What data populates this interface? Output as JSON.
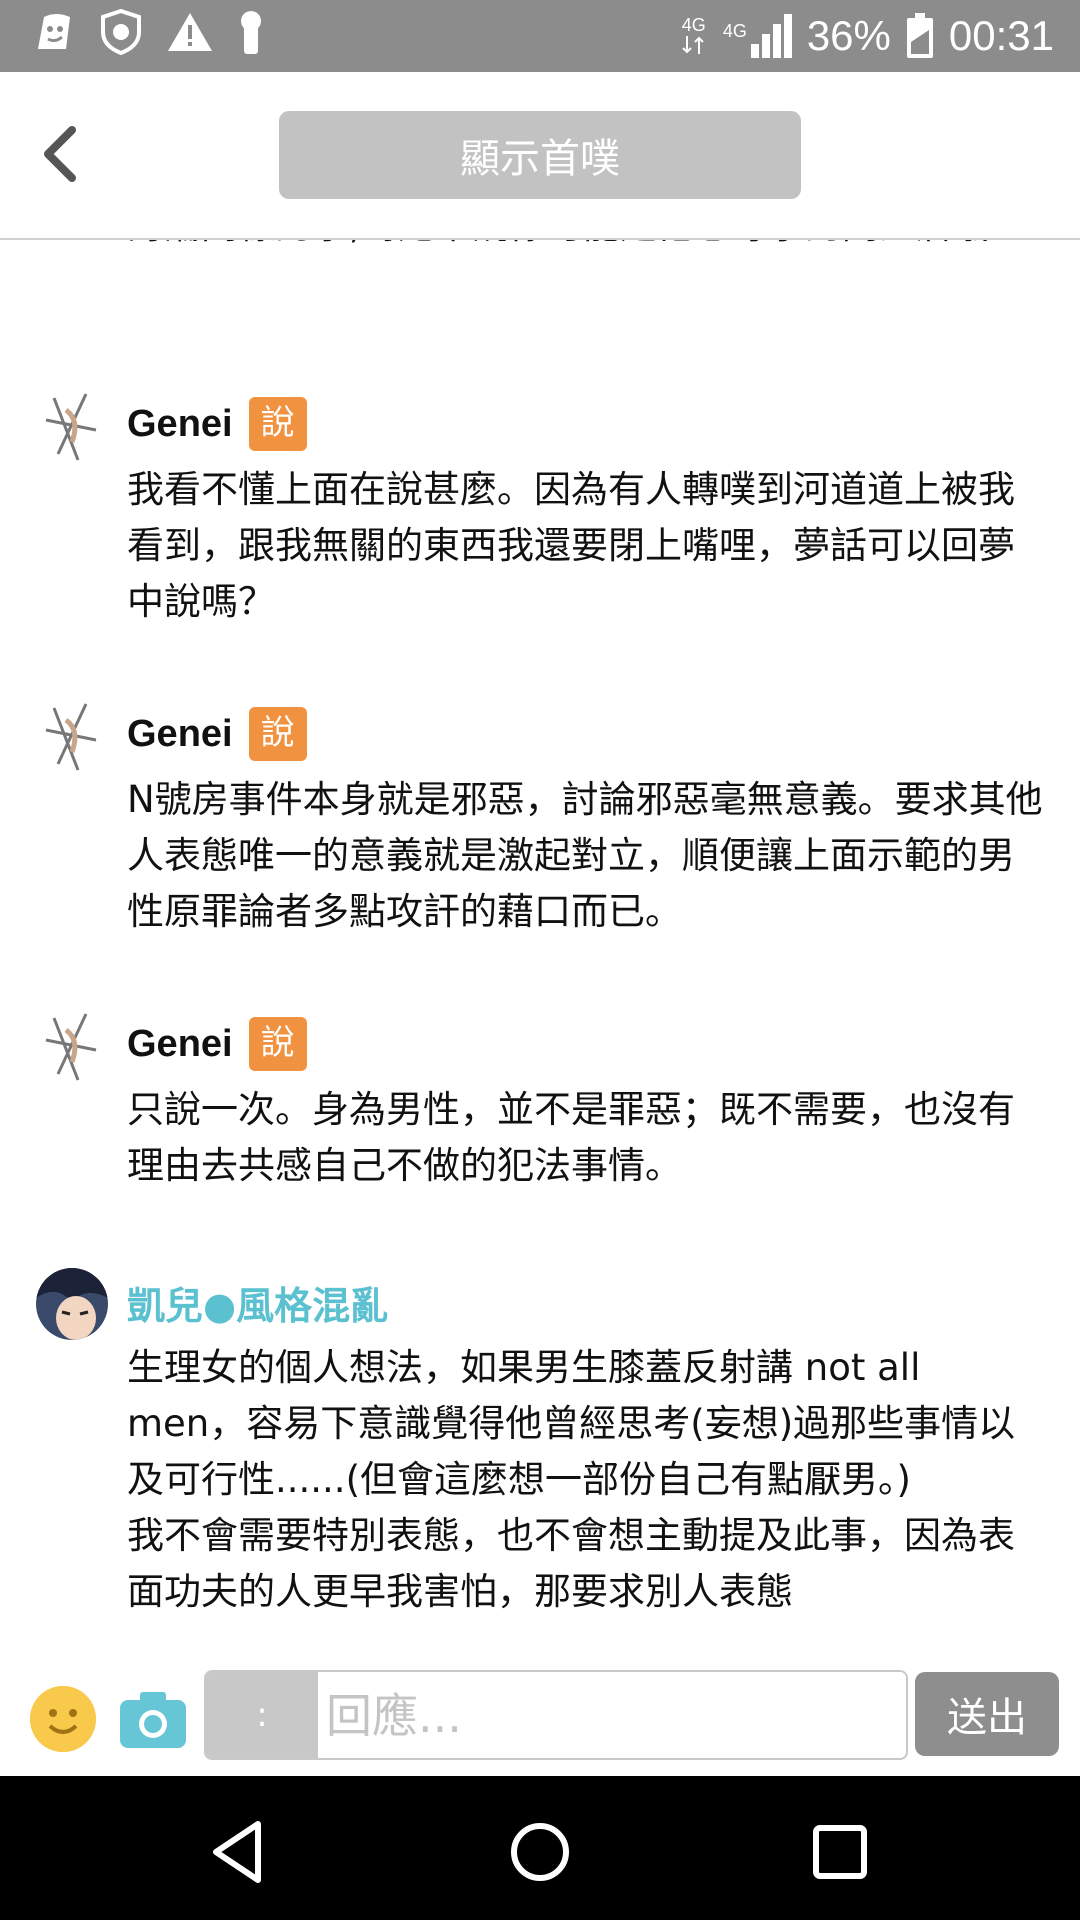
{
  "status_bar": {
    "network_left": "4G",
    "network_right": "4G",
    "battery": "36%",
    "time": "00:31"
  },
  "header": {
    "show_first_label": "顯示首噗"
  },
  "feed": {
    "partial_top_text": "討論同樣的事,對她來說你可能是他想尋求的同溫層哦XD",
    "responses": [
      {
        "name": "Genei",
        "qualifier": "說",
        "text": "我看不懂上面在說甚麼。因為有人轉噗到河道道上被我看到，跟我無關的東西我還要閉上嘴哩，夢話可以回夢中說嗎？"
      },
      {
        "name": "Genei",
        "qualifier": "說",
        "text": "N號房事件本身就是邪惡，討論邪惡毫無意義。要求其他人表態唯一的意義就是激起對立，順便讓上面示範的男性原罪論者多點攻訐的藉口而已。"
      },
      {
        "name": "Genei",
        "qualifier": "說",
        "text": "只說一次。身為男性，並不是罪惡；既不需要，也沒有理由去共感自己不做的犯法事情。"
      },
      {
        "name": "凱兒●風格混亂",
        "qualifier": "",
        "text": "生理女的個人想法，如果男生膝蓋反射講 not all men，容易下意識覺得他曾經思考(妄想)過那些事情以及可行性......(但會這麼想一部份自己有點厭男。)\n我不會需要特別表態，也不會想主動提及此事，因為表面功夫的人更早我害怕，那要求別人表態"
      }
    ]
  },
  "reply_bar": {
    "qualifier_value": ":",
    "placeholder": "回應...",
    "send_label": "送出"
  },
  "colors": {
    "status_bar": "#8c8c8c",
    "qualifier_bg": "#f09240",
    "teal_name": "#5bc0d0",
    "send_btn": "#8e8e8e"
  },
  "icons": {
    "status_left": [
      "face-icon",
      "shield-icon",
      "warning-icon",
      "keyhole-icon"
    ],
    "nav": [
      "back-triangle-icon",
      "home-circle-icon",
      "recents-square-icon"
    ]
  }
}
